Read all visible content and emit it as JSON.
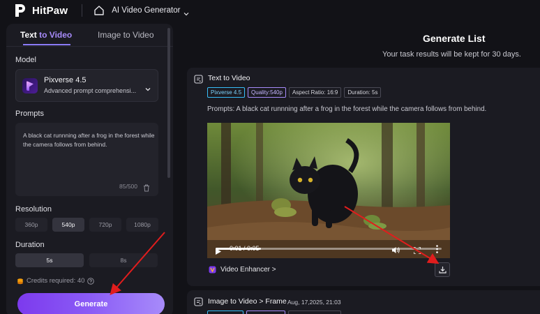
{
  "header": {
    "brand": "HitPaw",
    "app_name": "AI Video Generator"
  },
  "left_panel": {
    "tabs": [
      {
        "label_main": "Text ",
        "label_accent": "to Video",
        "active": true
      },
      {
        "label": "Image to Video",
        "active": false
      }
    ],
    "model_label": "Model",
    "model": {
      "name": "Pixverse 4.5",
      "description": "Advanced prompt comprehensi..."
    },
    "prompts_label": "Prompts",
    "prompt_text": "A black cat runnning after a frog in the forest while the camera follows from behind.",
    "prompt_count": "85/500",
    "resolution_label": "Resolution",
    "resolutions": [
      "360p",
      "540p",
      "720p",
      "1080p"
    ],
    "resolution_selected": "540p",
    "duration_label": "Duration",
    "durations": [
      "5s",
      "8s"
    ],
    "duration_selected": "5s",
    "credits_text": "Credits required: 40",
    "generate_label": "Generate"
  },
  "generate_list": {
    "title": "Generate List",
    "subtitle": "Your task results will be kept for 30 days."
  },
  "task1": {
    "title": "Text to Video",
    "tags": [
      "Pixverse 4.5",
      "Quality:540p",
      "Aspect Ratio: 16:9",
      "Duration: 5s"
    ],
    "prompt_line": "Prompts: A black cat runnning after a frog in the forest while the camera follows from behind.",
    "video_time": "0:01 / 0:05",
    "progress": 0.2,
    "enhancer_label": "Video Enhancer >"
  },
  "task2": {
    "title": "Image to Video > Frame",
    "date": "Aug, 17,2025, 21:03"
  },
  "colors": {
    "accent": "#8b5cf6",
    "tag_blue": "#38bdf8",
    "tag_purple": "#a78bfa",
    "annotation_arrow": "#e11d1d"
  }
}
